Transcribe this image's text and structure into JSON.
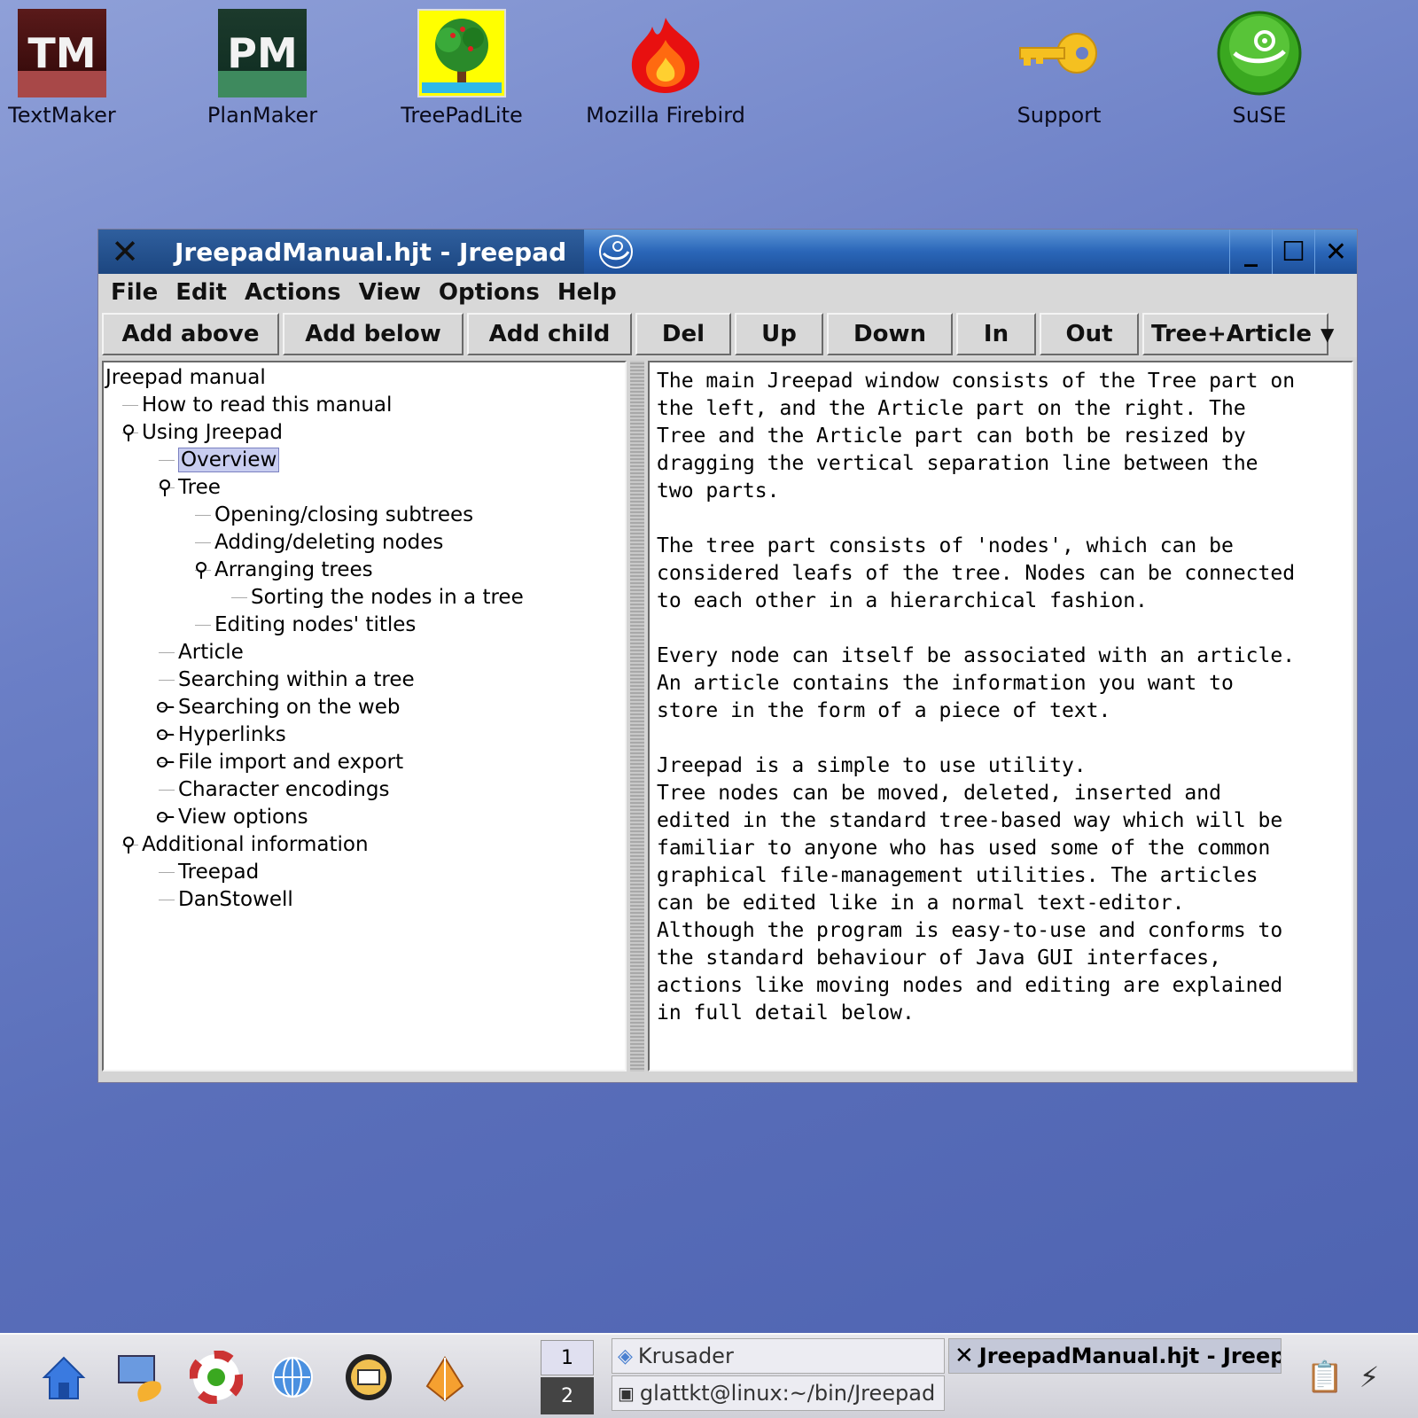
{
  "desktop": {
    "icons": [
      {
        "label": "TextMaker",
        "icon": "textmaker-icon",
        "tile_text": "TM"
      },
      {
        "label": "PlanMaker",
        "icon": "planmaker-icon",
        "tile_text": "PM"
      },
      {
        "label": "TreePadLite",
        "icon": "treepad-icon"
      },
      {
        "label": "Mozilla Firebird",
        "icon": "firebird-icon"
      },
      {
        "label": "Support",
        "icon": "key-icon"
      },
      {
        "label": "SuSE",
        "icon": "suse-icon"
      }
    ]
  },
  "window": {
    "title": "JreepadManual.hjt - Jreepad",
    "menu": [
      "File",
      "Edit",
      "Actions",
      "View",
      "Options",
      "Help"
    ],
    "toolbar": {
      "add_above": "Add above",
      "add_below": "Add below",
      "add_child": "Add child",
      "del": "Del",
      "up": "Up",
      "down": "Down",
      "in": "In",
      "out": "Out",
      "view_select": "Tree+Article"
    },
    "tree": [
      {
        "label": "Jreepad manual",
        "level": 0
      },
      {
        "label": "How to read this manual",
        "level": 1
      },
      {
        "label": "Using Jreepad",
        "level": 1,
        "toggle": "expanded"
      },
      {
        "label": "Overview",
        "level": 2,
        "selected": true
      },
      {
        "label": "Tree",
        "level": 2,
        "toggle": "expanded"
      },
      {
        "label": "Opening/closing subtrees",
        "level": 3
      },
      {
        "label": "Adding/deleting nodes",
        "level": 3
      },
      {
        "label": "Arranging trees",
        "level": 3,
        "toggle": "expanded"
      },
      {
        "label": "Sorting the nodes in a tree",
        "level": 4
      },
      {
        "label": "Editing nodes' titles",
        "level": 3
      },
      {
        "label": "Article",
        "level": 2
      },
      {
        "label": "Searching within a tree",
        "level": 2
      },
      {
        "label": "Searching on the web",
        "level": 2,
        "toggle": "collapsed"
      },
      {
        "label": "Hyperlinks",
        "level": 2,
        "toggle": "collapsed"
      },
      {
        "label": "File import and export",
        "level": 2,
        "toggle": "collapsed"
      },
      {
        "label": "Character encodings",
        "level": 2
      },
      {
        "label": "View options",
        "level": 2,
        "toggle": "collapsed"
      },
      {
        "label": "Additional information",
        "level": 1,
        "toggle": "expanded"
      },
      {
        "label": "Treepad",
        "level": 2
      },
      {
        "label": "DanStowell",
        "level": 2
      }
    ],
    "article": [
      "The main Jreepad window consists of the Tree part on\nthe left, and the Article part on the right. The\nTree and the Article part can both be resized by\ndragging the vertical separation line between the\ntwo parts.",
      "The tree part consists of 'nodes', which can be\nconsidered leafs of the tree. Nodes can be connected\nto each other in a hierarchical fashion.",
      "Every node can itself be associated with an article.\nAn article contains the information you want to\nstore in the form of a piece of text.",
      "Jreepad is a simple to use utility.\nTree nodes can be moved, deleted, inserted and\nedited in the standard tree-based way which will be\nfamiliar to anyone who has used some of the common\ngraphical file-management utilities. The articles\ncan be edited like in a normal text-editor.\nAlthough the program is easy-to-use and conforms to\nthe standard behaviour of Java GUI interfaces,\nactions like moving nodes and editing are explained\nin full detail below."
    ]
  },
  "taskbar": {
    "pager": [
      "1",
      "2"
    ],
    "tasks": [
      {
        "label": "Krusader",
        "active": false
      },
      {
        "label": "glattkt@linux:~/bin/Jreepad",
        "active": false
      },
      {
        "label": "JreepadManual.hjt - Jreepad",
        "active": true
      }
    ]
  }
}
